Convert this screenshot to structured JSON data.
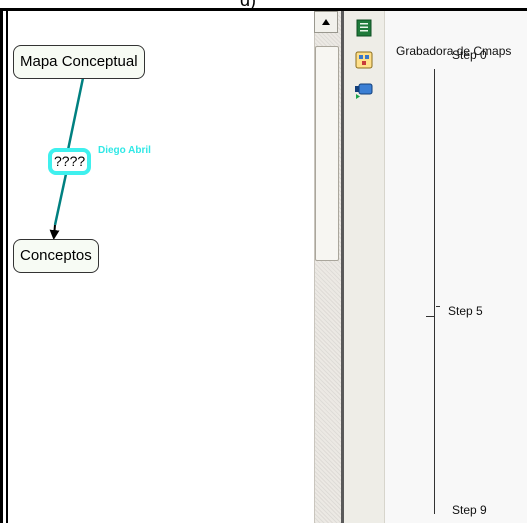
{
  "caption": "d)",
  "concept_map": {
    "top_concept": "Mapa Conceptual",
    "bottom_concept": "Conceptos",
    "linking_phrase": "????",
    "author": "Diego Abril"
  },
  "panel": {
    "title": "Grabadora de Cmaps",
    "steps": [
      "Step 0",
      "Step 5",
      "Step 9"
    ]
  },
  "colors": {
    "link_line": "#008080",
    "link_highlight": "#3ff0ee",
    "author_text": "#30e8e6",
    "node_fill": "#f7fbf4"
  },
  "icons": {
    "sidebar": [
      "notes-icon",
      "map-structure-icon",
      "recorder-icon"
    ],
    "scrollbar": "arrow-up-icon"
  }
}
